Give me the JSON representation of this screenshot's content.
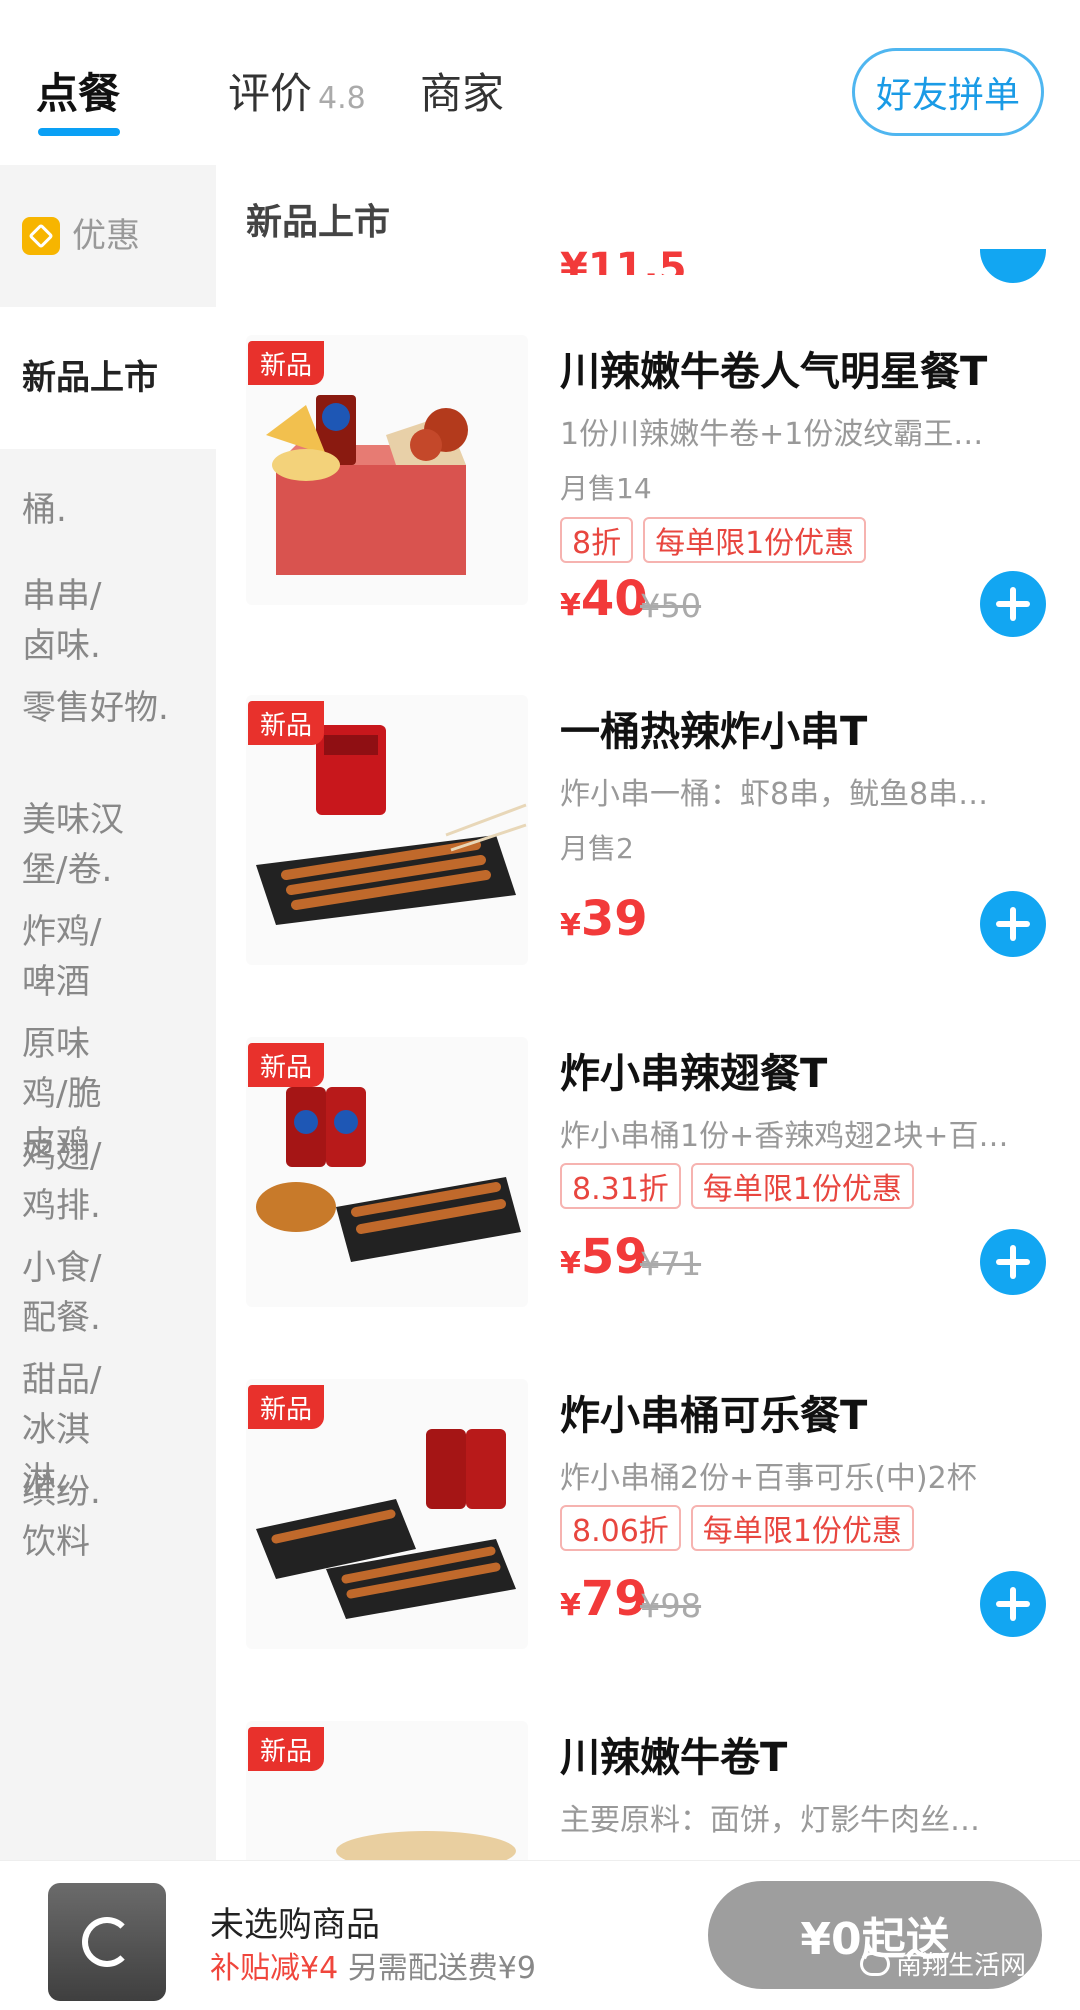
{
  "header": {
    "tabs": [
      {
        "label": "点餐",
        "active": true
      },
      {
        "label": "评价",
        "rating": "4.8"
      },
      {
        "label": "商家"
      }
    ],
    "group_order_label": "好友拼单",
    "accent_color": "#0aa0f5"
  },
  "sidebar": {
    "promo_label": "优惠",
    "active_label": "新品上市",
    "categories": [
      "桶.",
      "串串/卤味.",
      "零售好物.",
      "美味汉堡/卷.",
      "炸鸡/啤酒",
      "原味鸡/脆皮鸡",
      "鸡翅/鸡排.",
      "小食/配餐.",
      "甜品/冰淇淋.",
      "缤纷.饮料"
    ]
  },
  "section": {
    "title": "新品上市",
    "prev_price": "¥11.5"
  },
  "badge_new": "新品",
  "items": [
    {
      "name": "川辣嫩牛卷人气明星餐T",
      "desc": "1份川辣嫩牛卷+1份波纹霸王…",
      "sales": "月售14",
      "tags": [
        "8折",
        "每单限1份优惠"
      ],
      "price": "40",
      "orig": "¥50"
    },
    {
      "name": "一桶热辣炸小串T",
      "desc": "炸小串一桶：虾8串，鱿鱼8串…",
      "sales": "月售2",
      "tags": [],
      "price": "39",
      "orig": ""
    },
    {
      "name": "炸小串辣翅餐T",
      "desc": "炸小串桶1份+香辣鸡翅2块+百…",
      "sales": "",
      "tags": [
        "8.31折",
        "每单限1份优惠"
      ],
      "price": "59",
      "orig": "¥71"
    },
    {
      "name": "炸小串桶可乐餐T",
      "desc": "炸小串桶2份+百事可乐(中)2杯",
      "sales": "",
      "tags": [
        "8.06折",
        "每单限1份优惠"
      ],
      "price": "79",
      "orig": "¥98"
    },
    {
      "name": "川辣嫩牛卷T",
      "desc": "主要原料：面饼，灯影牛肉丝…",
      "sales": "",
      "tags": [],
      "price": "",
      "orig": ""
    }
  ],
  "currency": "¥",
  "cart": {
    "empty_text": "未选购商品",
    "subsidy_text": "补贴减¥4",
    "delivery_text": "另需配送费¥9",
    "min_order_label": "¥0起送",
    "watermark": "南翔生活网"
  }
}
